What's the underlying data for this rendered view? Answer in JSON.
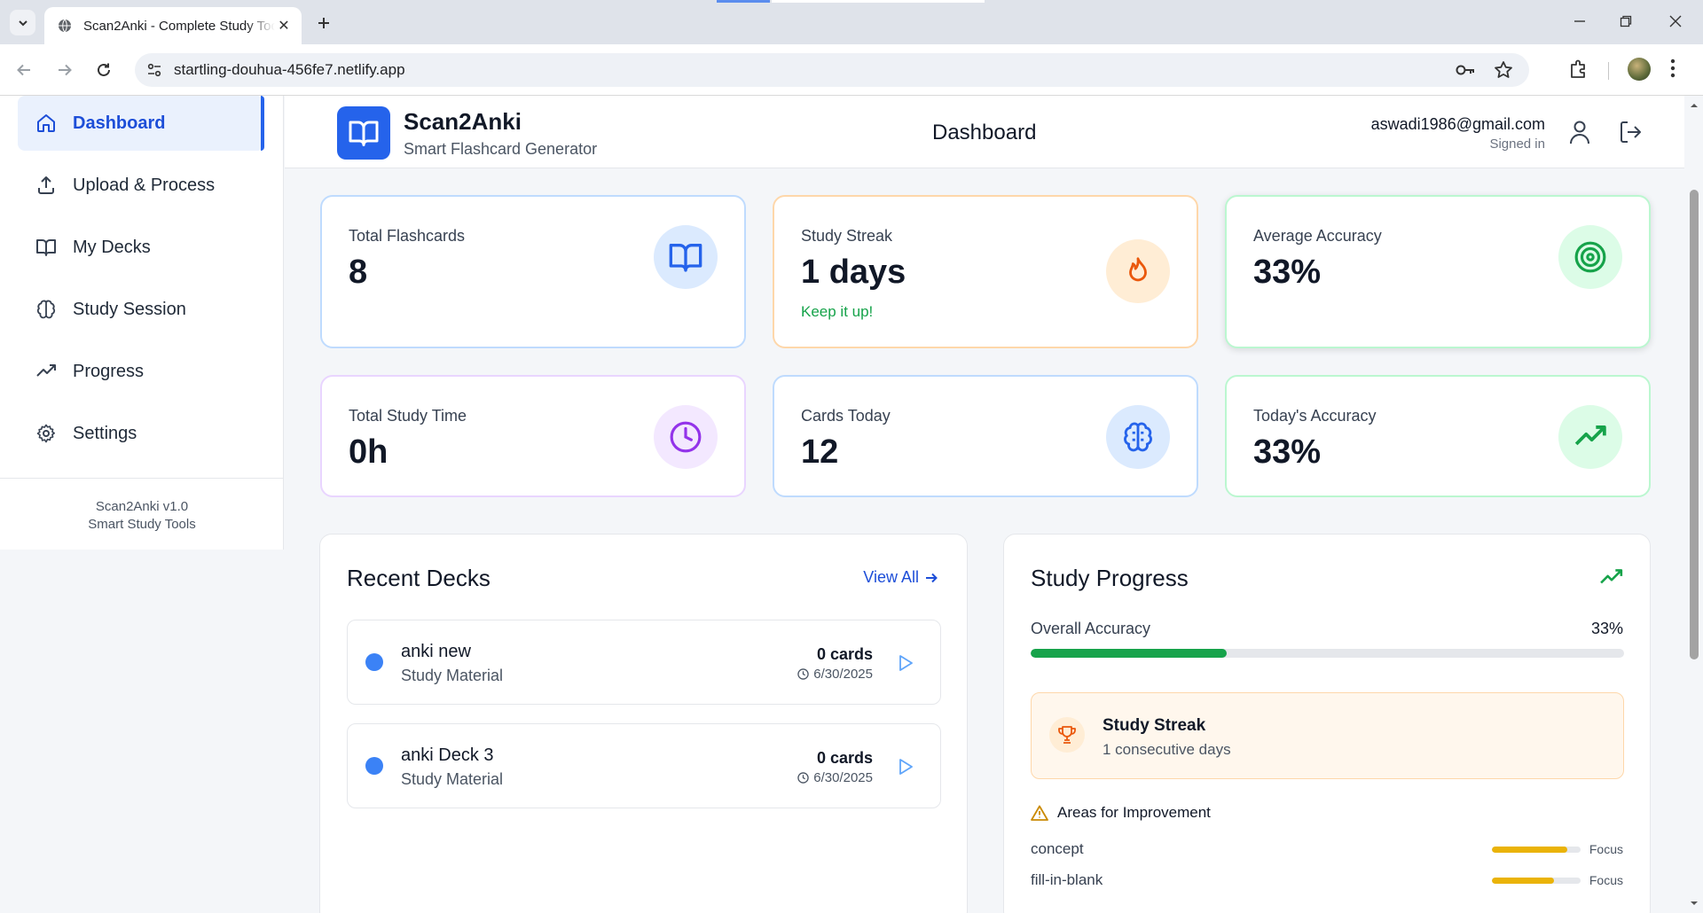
{
  "browser": {
    "tab_title": "Scan2Anki - Complete Study Tools",
    "url": "startling-douhua-456fe7.netlify.app"
  },
  "sidebar": {
    "items": [
      {
        "label": "Dashboard",
        "icon": "home-icon",
        "active": true
      },
      {
        "label": "Upload & Process",
        "icon": "upload-icon",
        "active": false
      },
      {
        "label": "My Decks",
        "icon": "book-icon",
        "active": false
      },
      {
        "label": "Study Session",
        "icon": "brain-icon",
        "active": false
      },
      {
        "label": "Progress",
        "icon": "trending-up-icon",
        "active": false
      },
      {
        "label": "Settings",
        "icon": "gear-icon",
        "active": false
      }
    ],
    "footer_version": "Scan2Anki v1.0",
    "footer_tagline": "Smart Study Tools"
  },
  "header": {
    "brand": "Scan2Anki",
    "brand_sub": "Smart Flashcard Generator",
    "page_title": "Dashboard",
    "user_email": "aswadi1986@gmail.com",
    "user_status": "Signed in"
  },
  "stats": [
    {
      "label": "Total Flashcards",
      "value": "8",
      "note": "",
      "icon": "book-open-icon",
      "accent": "#2563eb"
    },
    {
      "label": "Study Streak",
      "value": "1 days",
      "note": "Keep it up!",
      "icon": "flame-icon",
      "accent": "#ea580c"
    },
    {
      "label": "Average Accuracy",
      "value": "33%",
      "note": "",
      "icon": "target-icon",
      "accent": "#16a34a"
    },
    {
      "label": "Total Study Time",
      "value": "0h",
      "note": "",
      "icon": "clock-icon",
      "accent": "#9333ea"
    },
    {
      "label": "Cards Today",
      "value": "12",
      "note": "",
      "icon": "brain-icon",
      "accent": "#2563eb"
    },
    {
      "label": "Today's Accuracy",
      "value": "33%",
      "note": "",
      "icon": "trending-up-icon",
      "accent": "#16a34a"
    }
  ],
  "recent_decks": {
    "title": "Recent Decks",
    "view_all": "View All",
    "items": [
      {
        "name": "anki new",
        "type": "Study Material",
        "cards": "0 cards",
        "date": "6/30/2025"
      },
      {
        "name": "anki Deck 3",
        "type": "Study Material",
        "cards": "0 cards",
        "date": "6/30/2025"
      }
    ]
  },
  "study_progress": {
    "title": "Study Progress",
    "overall_label": "Overall Accuracy",
    "overall_value": "33%",
    "overall_fraction": 0.33,
    "streak_title": "Study Streak",
    "streak_text": "1 consecutive days",
    "improvement_title": "Areas for Improvement",
    "areas": [
      {
        "name": "concept",
        "level": 0.85,
        "tag": "Focus"
      },
      {
        "name": "fill-in-blank",
        "level": 0.7,
        "tag": "Focus"
      }
    ]
  },
  "colors": {
    "primary": "#2563eb",
    "success": "#16a34a",
    "warning_bar": "#eab308"
  }
}
